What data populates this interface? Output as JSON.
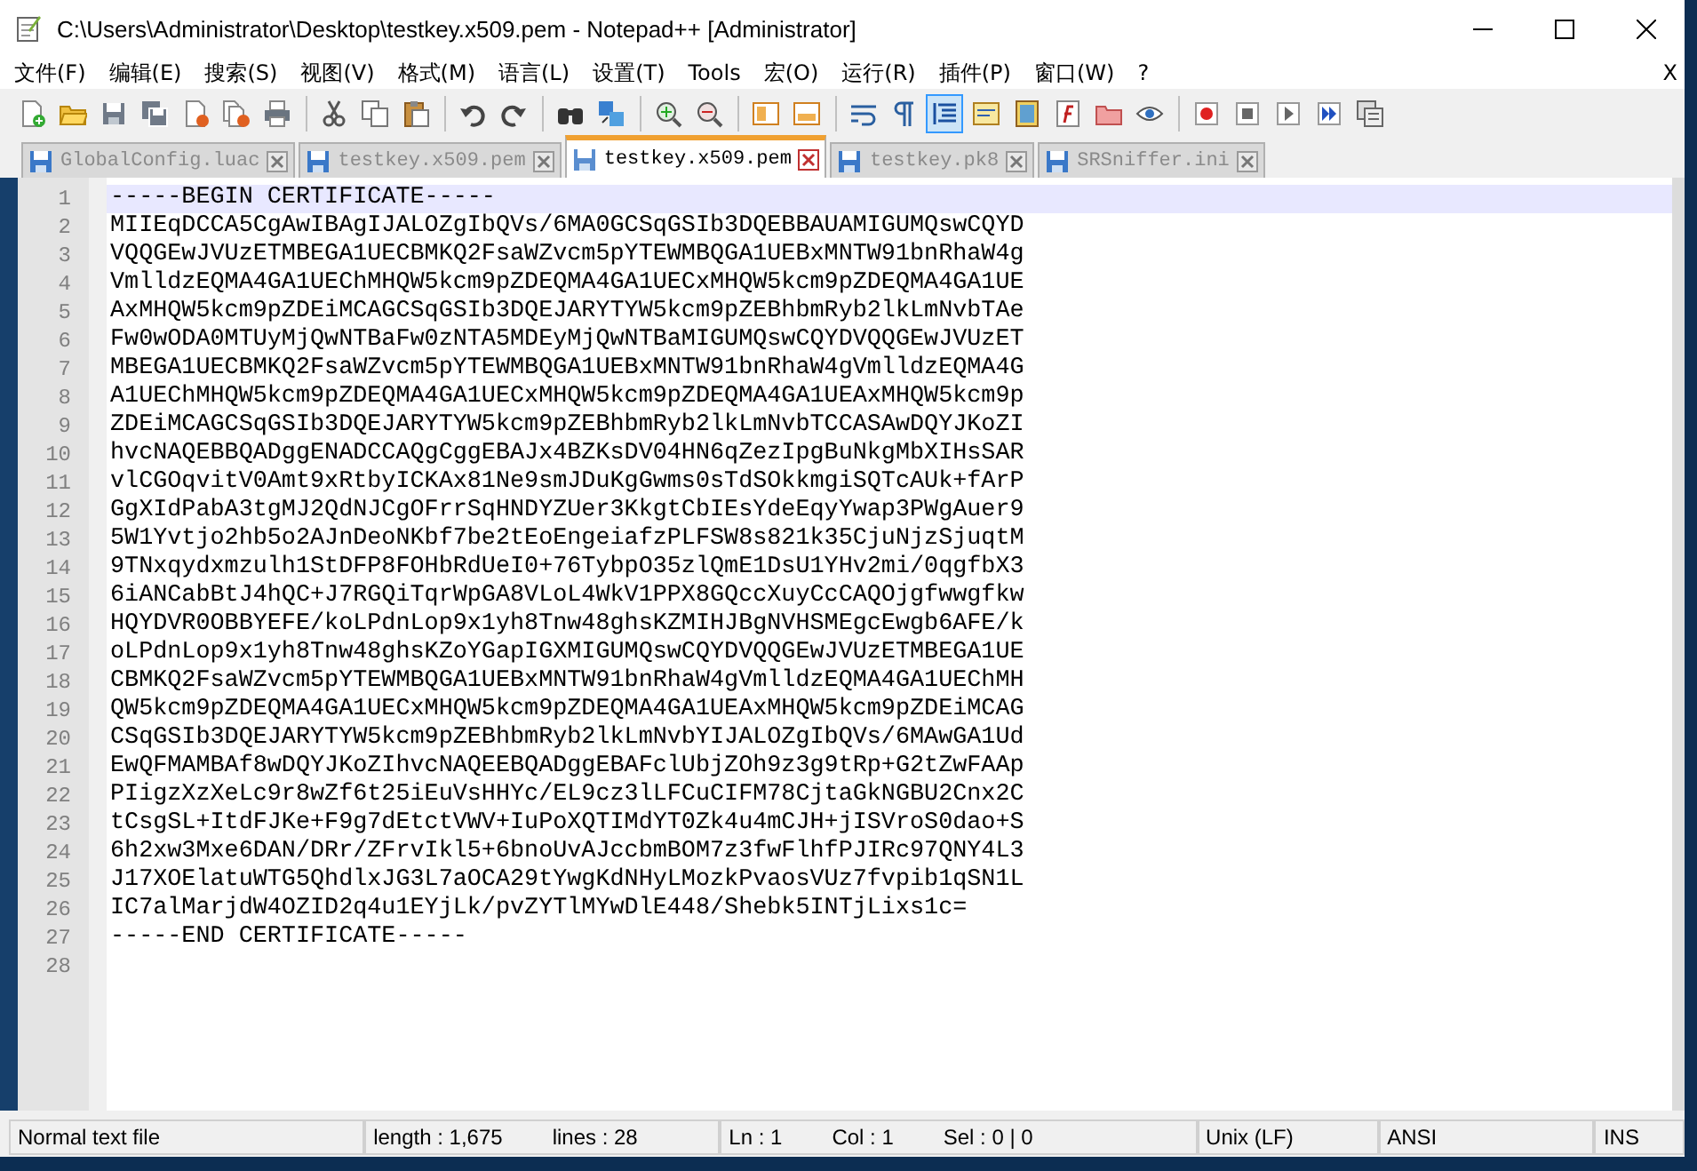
{
  "window": {
    "title": "C:\\Users\\Administrator\\Desktop\\testkey.x509.pem - Notepad++ [Administrator]"
  },
  "menu": [
    "文件(F)",
    "编辑(E)",
    "搜索(S)",
    "视图(V)",
    "格式(M)",
    "语言(L)",
    "设置(T)",
    "Tools",
    "宏(O)",
    "运行(R)",
    "插件(P)",
    "窗口(W)",
    "?"
  ],
  "menu_close": "X",
  "toolbar": [
    {
      "buttons": [
        {
          "kind": "new",
          "on": false
        },
        {
          "kind": "open",
          "on": false
        },
        {
          "kind": "save",
          "on": false
        },
        {
          "kind": "saveall",
          "on": false
        },
        {
          "kind": "close",
          "on": false
        },
        {
          "kind": "closeall",
          "on": false
        },
        {
          "kind": "print",
          "on": false
        }
      ]
    },
    {
      "buttons": [
        {
          "kind": "cut",
          "on": false
        },
        {
          "kind": "copy",
          "on": false
        },
        {
          "kind": "paste",
          "on": false
        }
      ]
    },
    {
      "buttons": [
        {
          "kind": "undo",
          "on": false
        },
        {
          "kind": "redo",
          "on": false
        }
      ]
    },
    {
      "buttons": [
        {
          "kind": "find",
          "on": false
        },
        {
          "kind": "replace",
          "on": false
        }
      ]
    },
    {
      "buttons": [
        {
          "kind": "zoomin",
          "on": false
        },
        {
          "kind": "zoomout",
          "on": false
        }
      ]
    },
    {
      "buttons": [
        {
          "kind": "syncv",
          "on": false
        },
        {
          "kind": "synch",
          "on": false
        }
      ]
    },
    {
      "buttons": [
        {
          "kind": "wrap",
          "on": false
        },
        {
          "kind": "allchars",
          "on": false
        },
        {
          "kind": "indent",
          "on": true
        },
        {
          "kind": "udl",
          "on": false
        },
        {
          "kind": "docmap",
          "on": false
        },
        {
          "kind": "funclist",
          "on": false
        },
        {
          "kind": "folder",
          "on": false
        },
        {
          "kind": "monitor",
          "on": false
        }
      ]
    },
    {
      "buttons": [
        {
          "kind": "record",
          "on": false
        },
        {
          "kind": "stop",
          "on": false
        },
        {
          "kind": "play",
          "on": false
        },
        {
          "kind": "playmulti",
          "on": false
        },
        {
          "kind": "savemacro",
          "on": false
        }
      ]
    }
  ],
  "tabs": [
    {
      "label": "GlobalConfig.luac",
      "selected": false
    },
    {
      "label": "testkey.x509.pem",
      "selected": false
    },
    {
      "label": "testkey.x509.pem",
      "selected": true
    },
    {
      "label": "testkey.pk8",
      "selected": false
    },
    {
      "label": "SRSniffer.ini",
      "selected": false
    }
  ],
  "editor": {
    "lines": [
      {
        "number": "1",
        "text": "-----BEGIN CERTIFICATE-----",
        "current": true
      },
      {
        "number": "2",
        "text": "MIIEqDCCA5CgAwIBAgIJALOZgIbQVs/6MA0GCSqGSIb3DQEBBAUAMIGUMQswCQYD",
        "current": false
      },
      {
        "number": "3",
        "text": "VQQGEwJVUzETMBEGA1UECBMKQ2FsaWZvcm5pYTEWMBQGA1UEBxMNTW91bnRhaW4g",
        "current": false
      },
      {
        "number": "4",
        "text": "VmlldzEQMA4GA1UEChMHQW5kcm9pZDEQMA4GA1UECxMHQW5kcm9pZDEQMA4GA1UE",
        "current": false
      },
      {
        "number": "5",
        "text": "AxMHQW5kcm9pZDEiMCAGCSqGSIb3DQEJARYTYW5kcm9pZEBhbmRyb2lkLmNvbTAe",
        "current": false
      },
      {
        "number": "6",
        "text": "Fw0wODA0MTUyMjQwNTBaFw0zNTA5MDEyMjQwNTBaMIGUMQswCQYDVQQGEwJVUzET",
        "current": false
      },
      {
        "number": "7",
        "text": "MBEGA1UECBMKQ2FsaWZvcm5pYTEWMBQGA1UEBxMNTW91bnRhaW4gVmlldzEQMA4G",
        "current": false
      },
      {
        "number": "8",
        "text": "A1UEChMHQW5kcm9pZDEQMA4GA1UECxMHQW5kcm9pZDEQMA4GA1UEAxMHQW5kcm9p",
        "current": false
      },
      {
        "number": "9",
        "text": "ZDEiMCAGCSqGSIb3DQEJARYTYW5kcm9pZEBhbmRyb2lkLmNvbTCCASAwDQYJKoZI",
        "current": false
      },
      {
        "number": "10",
        "text": "hvcNAQEBBQADggENADCCAQgCggEBAJx4BZKsDV04HN6qZezIpgBuNkgMbXIHsSAR",
        "current": false
      },
      {
        "number": "11",
        "text": "vlCGOqvitV0Amt9xRtbyICKAx81Ne9smJDuKgGwms0sTdSOkkmgiSQTcAUk+fArP",
        "current": false
      },
      {
        "number": "12",
        "text": "GgXIdPabA3tgMJ2QdNJCgOFrrSqHNDYZUer3KkgtCbIEsYdeEqyYwap3PWgAuer9",
        "current": false
      },
      {
        "number": "13",
        "text": "5W1Yvtjo2hb5o2AJnDeoNKbf7be2tEoEngeiafzPLFSW8s821k35CjuNjzSjuqtM",
        "current": false
      },
      {
        "number": "14",
        "text": "9TNxqydxmzulh1StDFP8FOHbRdUeI0+76TybpO35zlQmE1DsU1YHv2mi/0qgfbX3",
        "current": false
      },
      {
        "number": "15",
        "text": "6iANCabBtJ4hQC+J7RGQiTqrWpGA8VLoL4WkV1PPX8GQccXuyCcCAQOjgfwwgfkw",
        "current": false
      },
      {
        "number": "16",
        "text": "HQYDVR0OBBYEFE/koLPdnLop9x1yh8Tnw48ghsKZMIHJBgNVHSMEgcEwgb6AFE/k",
        "current": false
      },
      {
        "number": "17",
        "text": "oLPdnLop9x1yh8Tnw48ghsKZoYGapIGXMIGUMQswCQYDVQQGEwJVUzETMBEGA1UE",
        "current": false
      },
      {
        "number": "18",
        "text": "CBMKQ2FsaWZvcm5pYTEWMBQGA1UEBxMNTW91bnRhaW4gVmlldzEQMA4GA1UEChMH",
        "current": false
      },
      {
        "number": "19",
        "text": "QW5kcm9pZDEQMA4GA1UECxMHQW5kcm9pZDEQMA4GA1UEAxMHQW5kcm9pZDEiMCAG",
        "current": false
      },
      {
        "number": "20",
        "text": "CSqGSIb3DQEJARYTYW5kcm9pZEBhbmRyb2lkLmNvbYIJALOZgIbQVs/6MAwGA1Ud",
        "current": false
      },
      {
        "number": "21",
        "text": "EwQFMAMBAf8wDQYJKoZIhvcNAQEEBQADggEBAFclUbjZOh9z3g9tRp+G2tZwFAAp",
        "current": false
      },
      {
        "number": "22",
        "text": "PIigzXzXeLc9r8wZf6t25iEuVsHHYc/EL9cz3lLFCuCIFM78CjtaGkNGBU2Cnx2C",
        "current": false
      },
      {
        "number": "23",
        "text": "tCsgSL+ItdFJKe+F9g7dEtctVWV+IuPoXQTIMdYT0Zk4u4mCJH+jISVroS0dao+S",
        "current": false
      },
      {
        "number": "24",
        "text": "6h2xw3Mxe6DAN/DRr/ZFrvIkl5+6bnoUvAJccbmBOM7z3fwFlhfPJIRc97QNY4L3",
        "current": false
      },
      {
        "number": "25",
        "text": "J17XOElatuWTG5QhdlxJG3L7aOCA29tYwgKdNHyLMozkPvaosVUz7fvpib1qSN1L",
        "current": false
      },
      {
        "number": "26",
        "text": "IC7alMarjdW4OZID2q4u1EYjLk/pvZYTlMYwDlE448/Shebk5INTjLixs1c=",
        "current": false
      },
      {
        "number": "27",
        "text": "-----END CERTIFICATE-----",
        "current": false
      },
      {
        "number": "28",
        "current": false
      }
    ]
  },
  "status_bar": {
    "file_type": "Normal text file",
    "length": "length : 1,675",
    "lines": "lines : 28",
    "ln": "Ln : 1",
    "col": "Col : 1",
    "sel": "Sel : 0 | 0",
    "eol": "Unix (LF)",
    "encoding": "ANSI",
    "mode": "INS"
  }
}
